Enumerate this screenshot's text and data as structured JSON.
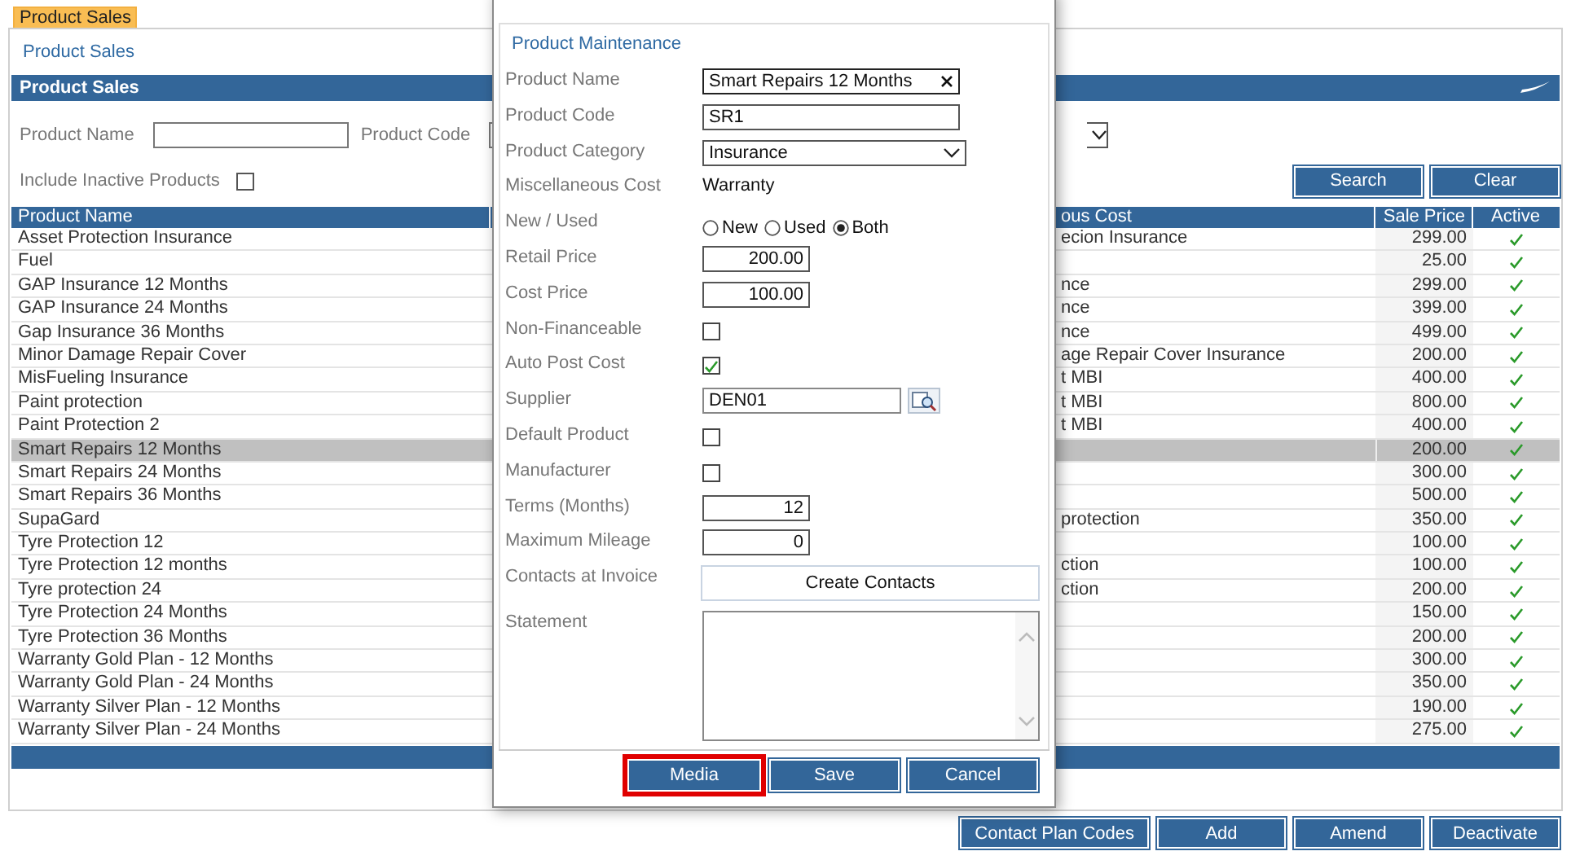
{
  "tab": {
    "label": "Product Sales",
    "selected": true
  },
  "breadcrumb": "Product Sales",
  "panel_title": "Product Sales",
  "filters": {
    "product_name_label": "Product Name",
    "product_code_label": "Product Code",
    "include_inactive_label": "Include Inactive Products",
    "include_inactive": false
  },
  "search_buttons": [
    "Search",
    "Clear"
  ],
  "table": {
    "columns": [
      "Product Name",
      "ous Cost",
      "Sale Price",
      "Active"
    ],
    "rows": [
      {
        "name": "Asset Protection Insurance",
        "column_2": "ecion Insurance",
        "price": "299.00",
        "active": true,
        "selected": false
      },
      {
        "name": "Fuel",
        "price": "25.00",
        "active": true,
        "selected": false
      },
      {
        "name": "GAP Insurance 12 Months",
        "column_2": "nce",
        "price": "299.00",
        "active": true,
        "selected": false
      },
      {
        "name": "GAP Insurance 24 Months",
        "column_2": "nce",
        "price": "399.00",
        "active": true,
        "selected": false
      },
      {
        "name": "Gap Insurance 36 Months",
        "column_2": "nce",
        "price": "499.00",
        "active": true,
        "selected": false
      },
      {
        "name": "Minor Damage Repair Cover",
        "column_2": "age Repair Cover Insurance",
        "price": "200.00",
        "active": true,
        "selected": false
      },
      {
        "name": "MisFueling Insurance",
        "column_2": "t MBI",
        "price": "400.00",
        "active": true,
        "selected": false
      },
      {
        "name": "Paint protection",
        "column_2": "t MBI",
        "price": "800.00",
        "active": true,
        "selected": false
      },
      {
        "name": "Paint Protection 2",
        "column_2": "t MBI",
        "price": "400.00",
        "active": true,
        "selected": false
      },
      {
        "name": "Smart Repairs 12 Months",
        "price": "200.00",
        "active": true,
        "selected": true
      },
      {
        "name": "Smart Repairs 24 Months",
        "price": "300.00",
        "active": true,
        "selected": false
      },
      {
        "name": "Smart Repairs 36 Months",
        "price": "500.00",
        "active": true,
        "selected": false
      },
      {
        "name": "SupaGard",
        "column_2": "protection",
        "price": "350.00",
        "active": true,
        "selected": false
      },
      {
        "name": "Tyre Protection 12",
        "price": "100.00",
        "active": true,
        "selected": false
      },
      {
        "name": "Tyre Protection 12 months",
        "column_2": "ction",
        "price": "100.00",
        "active": true,
        "selected": false
      },
      {
        "name": "Tyre protection 24",
        "column_2": "ction",
        "price": "200.00",
        "active": true,
        "selected": false
      },
      {
        "name": "Tyre Protection 24 Months",
        "price": "150.00",
        "active": true,
        "selected": false
      },
      {
        "name": "Tyre Protection 36 Months",
        "price": "200.00",
        "active": true,
        "selected": false
      },
      {
        "name": "Warranty Gold Plan - 12 Months",
        "price": "300.00",
        "active": true,
        "selected": false
      },
      {
        "name": "Warranty Gold Plan - 24 Months",
        "price": "350.00",
        "active": true,
        "selected": false
      },
      {
        "name": "Warranty Silver Plan - 12 Months",
        "price": "190.00",
        "active": true,
        "selected": false
      },
      {
        "name": "Warranty Silver Plan - 24 Months",
        "price": "275.00",
        "active": true,
        "selected": false
      }
    ]
  },
  "footer_buttons": [
    "Contact Plan Codes",
    "Add",
    "Amend",
    "Deactivate"
  ],
  "dialog": {
    "title": "Product Maintenance",
    "fields": [
      {
        "label": "Product Name",
        "kind": "clearable",
        "value": "Smart Repairs 12 Months"
      },
      {
        "label": "Product Code",
        "kind": "text",
        "value": "SR1"
      },
      {
        "label": "Product Category",
        "kind": "select",
        "value": "Insurance"
      },
      {
        "label": "Miscellaneous Cost",
        "kind": "static",
        "value": "Warranty"
      },
      {
        "label": "New / Used",
        "kind": "radio",
        "options": [
          {
            "label": "New",
            "selected": false
          },
          {
            "label": "Used",
            "selected": false
          },
          {
            "label": "Both",
            "selected": true
          }
        ]
      },
      {
        "label": "Retail Price",
        "kind": "number",
        "value": "200.00"
      },
      {
        "label": "Cost Price",
        "kind": "number",
        "value": "100.00"
      },
      {
        "label": "Non-Financeable",
        "kind": "checkbox",
        "checked": false
      },
      {
        "label": "Auto Post Cost",
        "kind": "checkbox",
        "checked": true
      },
      {
        "label": "Supplier",
        "kind": "lookup",
        "value": "DEN01"
      },
      {
        "label": "Default Product",
        "kind": "checkbox",
        "checked": false
      },
      {
        "label": "Manufacturer",
        "kind": "checkbox",
        "checked": false
      },
      {
        "label": "Terms (Months)",
        "kind": "number",
        "value": "12"
      },
      {
        "label": "Maximum Mileage",
        "kind": "number",
        "value": "0"
      },
      {
        "label": "Contacts at Invoice",
        "kind": "button",
        "value": "Create Contacts"
      },
      {
        "label": "Statement",
        "kind": "textarea"
      }
    ],
    "buttons": [
      {
        "label": "Media",
        "highlighted": true
      },
      {
        "label": "Save",
        "highlighted": false
      },
      {
        "label": "Cancel",
        "highlighted": false
      }
    ]
  }
}
